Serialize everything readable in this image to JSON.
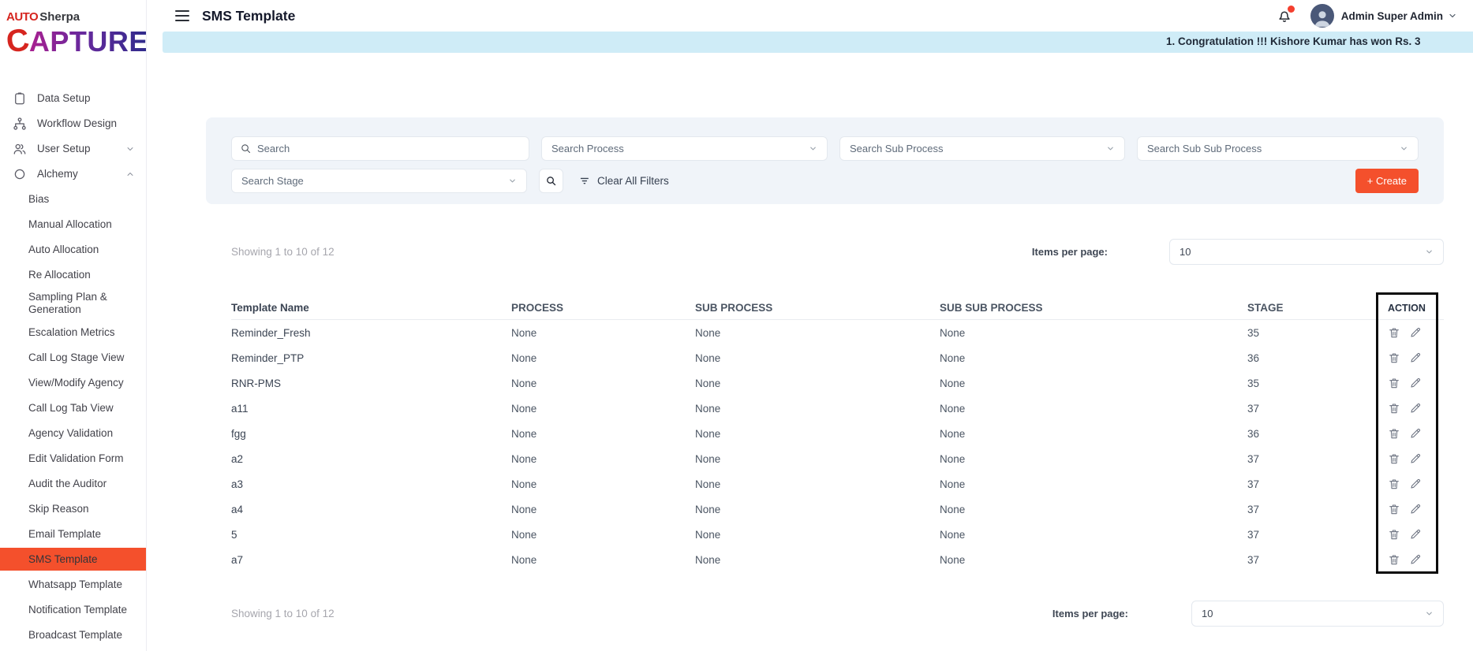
{
  "logo": {
    "top_left": "AUTO",
    "top_right": "Sherpa",
    "main_c": "C",
    "main_rest": "APTURE"
  },
  "header": {
    "title": "SMS Template",
    "user_name": "Admin Super Admin"
  },
  "banner": {
    "text": "1. Congratulation !!! Kishore Kumar has won Rs. 3",
    "bg_color": "#cfecf7"
  },
  "colors": {
    "accent": "#f4502c",
    "active_item_bg": "#f4502c",
    "banner_bg": "#cfecf7",
    "notification_dot": "#f43f2e"
  },
  "sidebar": {
    "items": [
      {
        "label": "Data Setup",
        "icon": "clipboard-icon"
      },
      {
        "label": "Workflow Design",
        "icon": "workflow-icon"
      },
      {
        "label": "User Setup",
        "icon": "users-icon",
        "chevron": "down"
      },
      {
        "label": "Alchemy",
        "icon": "circle-icon",
        "chevron": "up"
      }
    ],
    "alchemy_items": [
      {
        "label": "Bias"
      },
      {
        "label": "Manual Allocation"
      },
      {
        "label": "Auto Allocation"
      },
      {
        "label": "Re Allocation"
      },
      {
        "label": "Sampling Plan & Generation"
      },
      {
        "label": "Escalation Metrics"
      },
      {
        "label": "Call Log Stage View"
      },
      {
        "label": "View/Modify Agency"
      },
      {
        "label": "Call Log Tab View"
      },
      {
        "label": "Agency Validation"
      },
      {
        "label": "Edit Validation Form"
      },
      {
        "label": "Audit the Auditor"
      },
      {
        "label": "Skip Reason"
      },
      {
        "label": "Email Template"
      },
      {
        "label": "SMS Template",
        "active": true
      },
      {
        "label": "Whatsapp Template"
      },
      {
        "label": "Notification Template"
      },
      {
        "label": "Broadcast Template"
      }
    ]
  },
  "filters": {
    "search_placeholder": "Search",
    "process_placeholder": "Search Process",
    "sub_process_placeholder": "Search Sub Process",
    "sub_sub_process_placeholder": "Search Sub Sub Process",
    "stage_placeholder": "Search Stage",
    "clear_label": "Clear All Filters",
    "create_label": "+ Create"
  },
  "pagination": {
    "showing": "Showing 1 to 10 of 12",
    "items_per_page_label": "Items per page:",
    "items_per_page_value": "10"
  },
  "table": {
    "headers": {
      "name": "Template Name",
      "process": "PROCESS",
      "sub_process": "SUB PROCESS",
      "sub_sub_process": "SUB SUB PROCESS",
      "stage": "STAGE",
      "action": "ACTION"
    },
    "rows": [
      {
        "name": "Reminder_Fresh",
        "process": "None",
        "sub_process": "None",
        "sub_sub_process": "None",
        "stage": "35"
      },
      {
        "name": "Reminder_PTP",
        "process": "None",
        "sub_process": "None",
        "sub_sub_process": "None",
        "stage": "36"
      },
      {
        "name": "RNR-PMS",
        "process": "None",
        "sub_process": "None",
        "sub_sub_process": "None",
        "stage": "35"
      },
      {
        "name": "a11",
        "process": "None",
        "sub_process": "None",
        "sub_sub_process": "None",
        "stage": "37"
      },
      {
        "name": "fgg",
        "process": "None",
        "sub_process": "None",
        "sub_sub_process": "None",
        "stage": "36"
      },
      {
        "name": "a2",
        "process": "None",
        "sub_process": "None",
        "sub_sub_process": "None",
        "stage": "37"
      },
      {
        "name": "a3",
        "process": "None",
        "sub_process": "None",
        "sub_sub_process": "None",
        "stage": "37"
      },
      {
        "name": "a4",
        "process": "None",
        "sub_process": "None",
        "sub_sub_process": "None",
        "stage": "37"
      },
      {
        "name": "5",
        "process": "None",
        "sub_process": "None",
        "sub_sub_process": "None",
        "stage": "37"
      },
      {
        "name": "a7",
        "process": "None",
        "sub_process": "None",
        "sub_sub_process": "None",
        "stage": "37"
      }
    ]
  }
}
